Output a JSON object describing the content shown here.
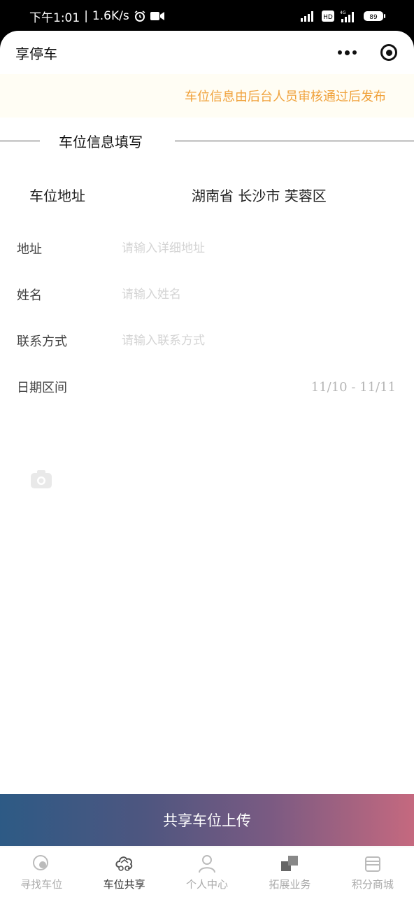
{
  "status_bar": {
    "time": "下午1:01",
    "speed": "1.6K/s",
    "battery": "89"
  },
  "nav": {
    "title": "享停车"
  },
  "notice": {
    "text": "车位信息由后台人员审核通过后发布"
  },
  "section": {
    "title": "车位信息填写"
  },
  "address": {
    "label": "车位地址",
    "value": "湖南省 长沙市 芙蓉区"
  },
  "form": {
    "detail_address": {
      "label": "地址",
      "placeholder": "请输入详细地址",
      "value": ""
    },
    "name": {
      "label": "姓名",
      "placeholder": "请输入姓名",
      "value": ""
    },
    "contact": {
      "label": "联系方式",
      "placeholder": "请输入联系方式",
      "value": ""
    },
    "date_range": {
      "label": "日期区间",
      "value": "11/10 - 11/11"
    }
  },
  "submit": {
    "label": "共享车位上传"
  },
  "tabs": [
    {
      "label": "寻找车位",
      "icon": "search-parking-icon",
      "active": false
    },
    {
      "label": "车位共享",
      "icon": "share-parking-icon",
      "active": true
    },
    {
      "label": "个人中心",
      "icon": "user-icon",
      "active": false
    },
    {
      "label": "拓展业务",
      "icon": "business-icon",
      "active": false
    },
    {
      "label": "积分商城",
      "icon": "shop-icon",
      "active": false
    }
  ],
  "colors": {
    "notice_text": "#f0a23c",
    "notice_bg": "#fffdf4",
    "gradient_start": "#2d5a85",
    "gradient_end": "#c5697f"
  }
}
